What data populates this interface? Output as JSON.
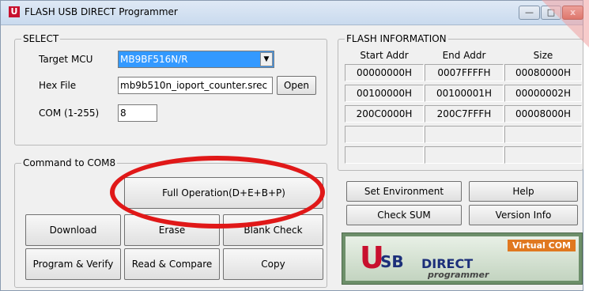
{
  "window": {
    "title": "FLASH USB DIRECT Programmer",
    "icon_letter": "U",
    "min_glyph": "—",
    "max_glyph": "□",
    "close_glyph": "x"
  },
  "select_group": {
    "legend": "SELECT",
    "target_label": "Target MCU",
    "target_value": "MB9BF516N/R",
    "hex_label": "Hex File",
    "hex_value": "mb9b510n_ioport_counter.srec",
    "open_label": "Open",
    "com_label": "COM (1-255)",
    "com_value": "8"
  },
  "command_group": {
    "legend": "Command to COM8",
    "full_operation": "Full Operation(D+E+B+P)",
    "download": "Download",
    "erase": "Erase",
    "blank_check": "Blank Check",
    "program_verify": "Program & Verify",
    "read_compare": "Read & Compare",
    "copy": "Copy"
  },
  "flash_info": {
    "legend": "FLASH INFORMATION",
    "headers": [
      "Start Addr",
      "End Addr",
      "Size"
    ],
    "rows": [
      [
        "00000000H",
        "0007FFFFH",
        "00080000H"
      ],
      [
        "00100000H",
        "00100001H",
        "00000002H"
      ],
      [
        "200C0000H",
        "200C7FFFH",
        "00008000H"
      ],
      [
        "",
        "",
        ""
      ],
      [
        "",
        "",
        ""
      ]
    ]
  },
  "side_buttons": {
    "set_environment": "Set Environment",
    "help": "Help",
    "check_sum": "Check SUM",
    "version_info": "Version Info"
  },
  "logo": {
    "u": "U",
    "sb": "SB",
    "direct": "DIRECT",
    "programmer": "programmer",
    "badge": "Virtual COM"
  },
  "colors": {
    "highlight_oval": "#e01818",
    "select_highlight": "#3399ff",
    "logo_red": "#c8102e",
    "logo_blue": "#1c2f7a"
  }
}
